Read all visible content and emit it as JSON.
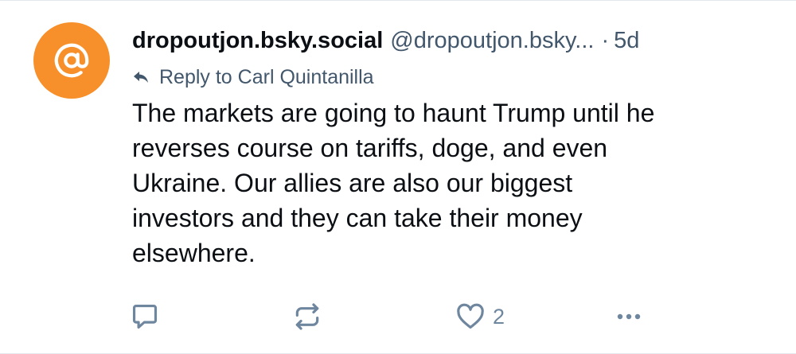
{
  "post": {
    "avatar_icon": "at-sign-icon",
    "avatar_color": "#f7902a",
    "display_name": "dropoutjon.bsky.social",
    "handle": "@dropoutjon.bsky...",
    "separator": "·",
    "timestamp": "5d",
    "reply_to": "Reply to Carl Quintanilla",
    "text": "The markets are going to haunt Trump until he\nreverses course on tariffs, doge, and even\nUkraine.  Our allies are also our biggest\ninvestors and they can take their money\nelsewhere.",
    "actions": {
      "reply_icon": "comment-icon",
      "repost_icon": "repost-icon",
      "like_icon": "heart-icon",
      "like_count": "2",
      "more_icon": "more-dots-icon"
    }
  }
}
